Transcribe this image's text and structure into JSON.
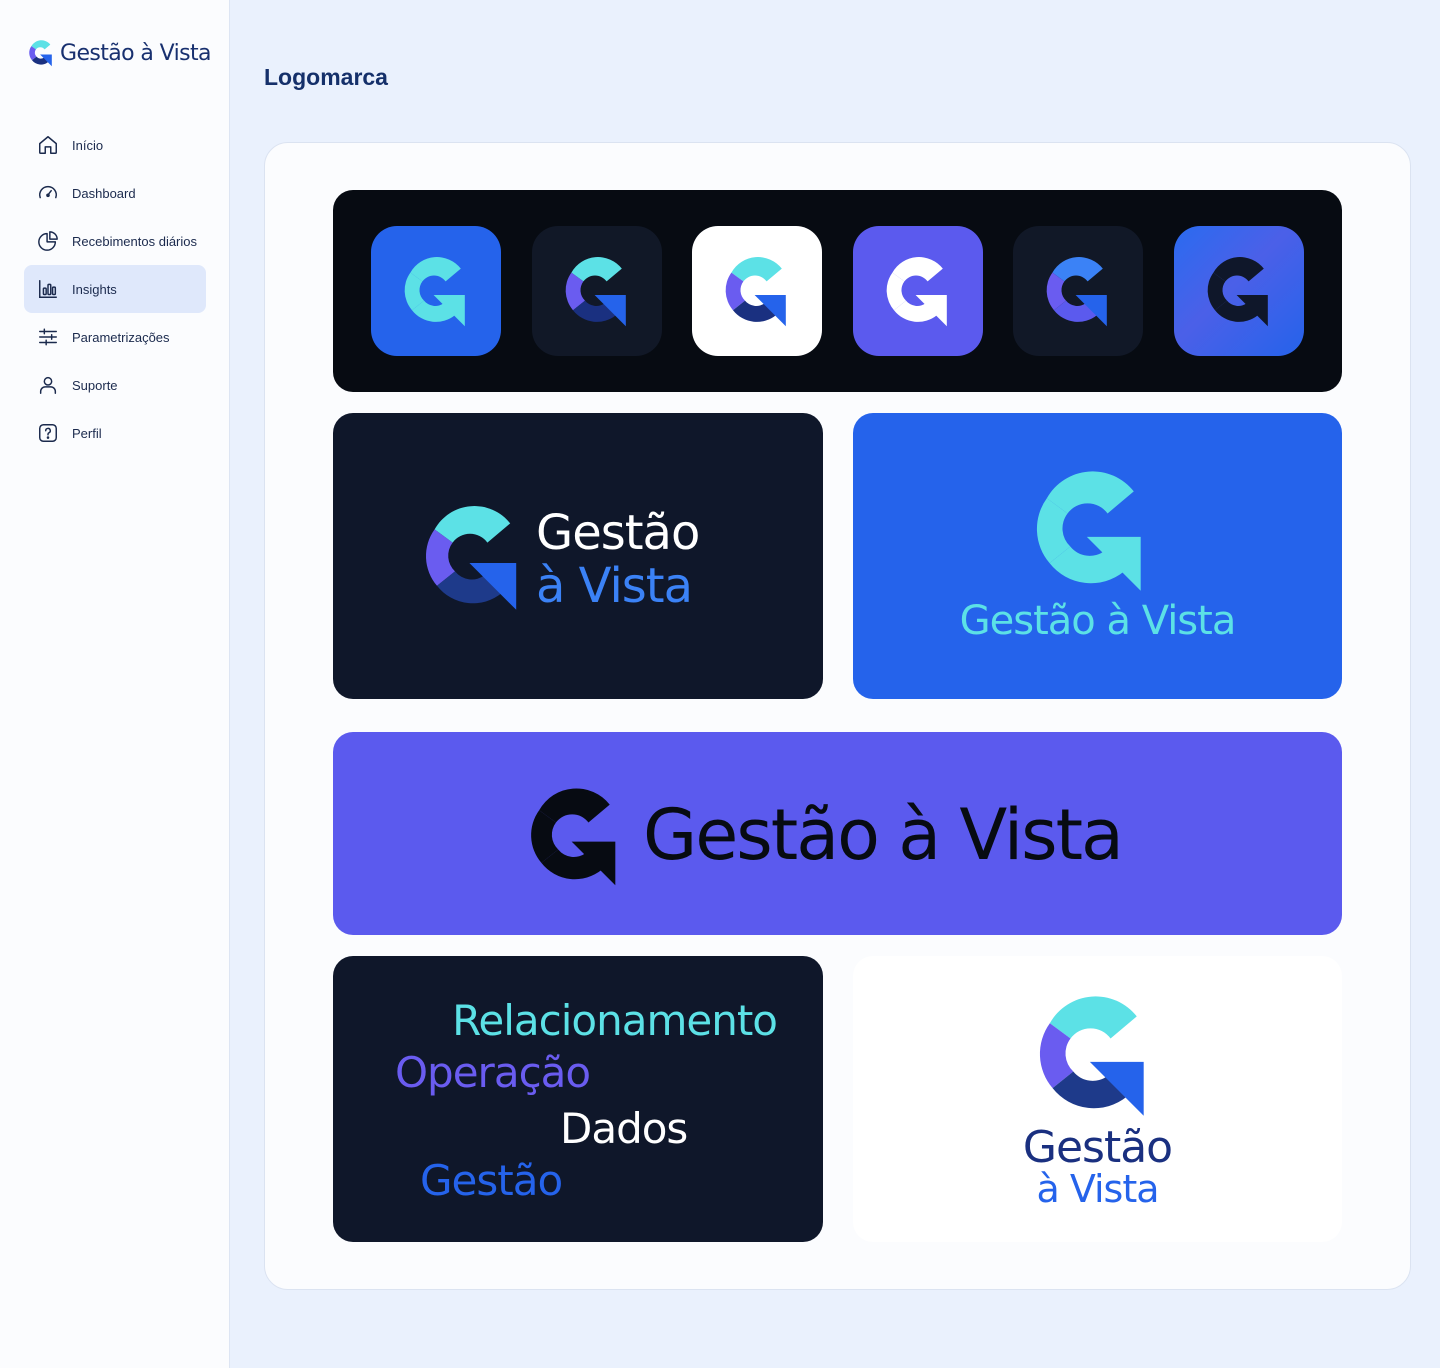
{
  "brand": {
    "name": "Gestão à Vista"
  },
  "sidebar": {
    "items": [
      {
        "label": "Início",
        "icon": "home-icon",
        "active": false
      },
      {
        "label": "Dashboard",
        "icon": "gauge-icon",
        "active": false
      },
      {
        "label": "Recebimentos diários",
        "icon": "pie-chart-icon",
        "active": false
      },
      {
        "label": "Insights",
        "icon": "bar-chart-icon",
        "active": true
      },
      {
        "label": "Parametrizações",
        "icon": "sliders-icon",
        "active": false
      },
      {
        "label": "Suporte",
        "icon": "user-icon",
        "active": false
      },
      {
        "label": "Perfil",
        "icon": "help-icon",
        "active": false
      }
    ]
  },
  "main": {
    "title": "Logomarca",
    "dark_logo": {
      "line1": "Gestão",
      "line2": "à Vista"
    },
    "blue_logo": {
      "text": "Gestão à Vista"
    },
    "purple_logo": {
      "text": "Gestão à Vista"
    },
    "words": [
      "Relacionamento",
      "Operação",
      "Dados",
      "Gestão"
    ],
    "white_logo": {
      "line1": "Gestão",
      "line2": "à Vista"
    }
  },
  "colors": {
    "navy": "#1a3080",
    "blue": "#2563eb",
    "cyan": "#5ce1e6",
    "purple": "#6a5cf0",
    "dark": "#0f172a",
    "black": "#070b12"
  }
}
